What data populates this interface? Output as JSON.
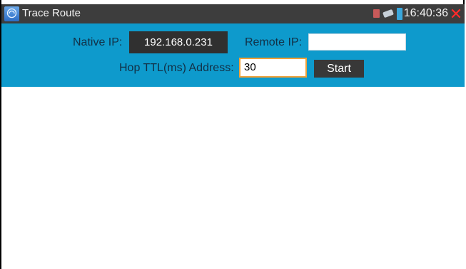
{
  "titlebar": {
    "title": "Trace Route",
    "clock": "16:40:36",
    "icons": [
      "app-icon",
      "sim-icon",
      "usb-icon",
      "battery-icon",
      "close-icon"
    ],
    "close_glyph": "✕",
    "close_color": "#ff2a2a"
  },
  "toolbar": {
    "background": "#0e9acc",
    "native_ip_label": "Native IP:",
    "native_ip_value": "192.168.0.231",
    "remote_ip_label": "Remote IP:",
    "remote_ip_value": "",
    "hop_label": "Hop TTL(ms) Address:",
    "hop_value": "30",
    "start_label": "Start"
  },
  "results": {
    "lines": []
  }
}
